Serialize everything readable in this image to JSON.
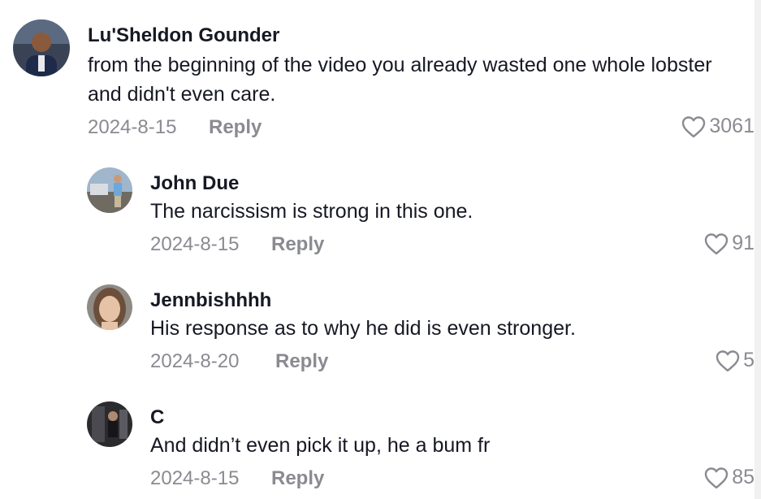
{
  "comments": [
    {
      "username": "Lu'Sheldon Gounder",
      "text": "from the beginning of the video you already wasted one whole lobster and didn't even care.",
      "date": "2024-8-15",
      "reply_label": "Reply",
      "likes": "3061"
    },
    {
      "username": "John Due",
      "text": "The narcissism is strong in this one.",
      "date": "2024-8-15",
      "reply_label": "Reply",
      "likes": "91"
    },
    {
      "username": "Jennbishhhh",
      "text": "His response as to why he did is even stronger.",
      "date": "2024-8-20",
      "reply_label": "Reply",
      "likes": "5"
    },
    {
      "username": "C",
      "text": "And didn’t even pick it up, he a bum fr",
      "date": "2024-8-15",
      "reply_label": "Reply",
      "likes": "85"
    }
  ],
  "icons": {
    "like": "heart-outline-icon"
  },
  "colors": {
    "text": "#161823",
    "muted": "#8a8b91",
    "background": "#ffffff"
  }
}
